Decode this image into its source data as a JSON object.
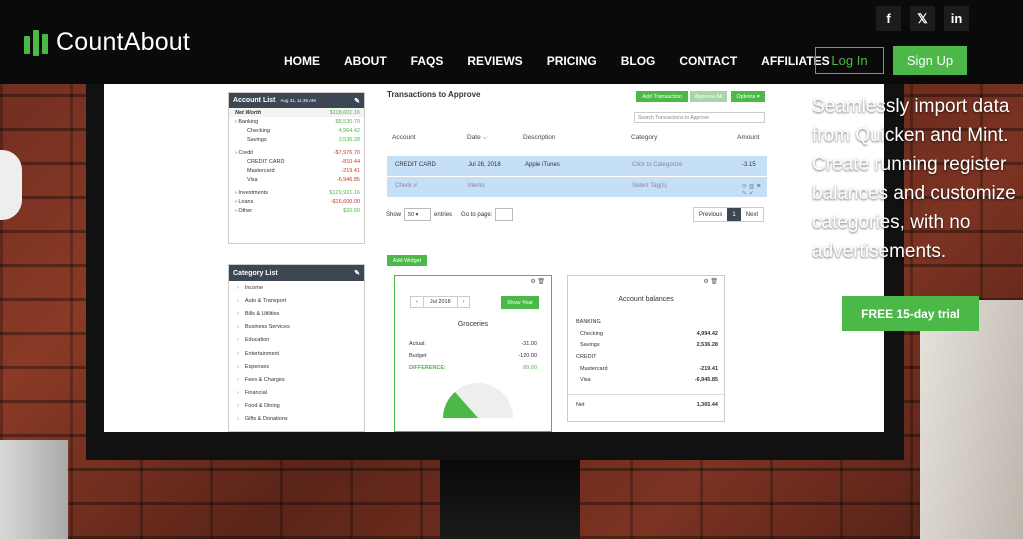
{
  "brand": {
    "name_part1": "Count",
    "name_part2": "About"
  },
  "social": [
    {
      "label": "f",
      "name": "facebook-icon"
    },
    {
      "label": "𝕏",
      "name": "twitter-icon"
    },
    {
      "label": "in",
      "name": "linkedin-icon"
    }
  ],
  "nav": [
    "HOME",
    "ABOUT",
    "FAQS",
    "REVIEWS",
    "PRICING",
    "BLOG",
    "CONTACT",
    "AFFILIATES"
  ],
  "auth": {
    "login": "Log In",
    "signup": "Sign Up"
  },
  "hero": {
    "text": "Seamlessly import data from Quicken and Mint. Create running register balances and customize categories, with no advertisements.",
    "cta": "FREE 15-day trial"
  },
  "app": {
    "account_list": {
      "title": "Account List",
      "date": "Aug 31, 11:35 AM",
      "rows": [
        {
          "label": "Net Worth",
          "value": "$118,601.16",
          "type": "hl",
          "color": "green"
        },
        {
          "label": "Banking",
          "value": "$8,530.70",
          "type": "group",
          "color": "green"
        },
        {
          "label": "Checking",
          "value": "4,964.42",
          "type": "sub",
          "color": "green"
        },
        {
          "label": "Savings",
          "value": "3,536.28",
          "type": "sub",
          "color": "green"
        },
        {
          "label": "",
          "value": "",
          "type": "spacer",
          "color": ""
        },
        {
          "label": "Credit",
          "value": "-$7,976.70",
          "type": "group",
          "color": "red"
        },
        {
          "label": "CREDIT CARD",
          "value": "-810.44",
          "type": "sub",
          "color": "red"
        },
        {
          "label": "Mastercard",
          "value": "-219.41",
          "type": "sub",
          "color": "red"
        },
        {
          "label": "Visa",
          "value": "-6,946.85",
          "type": "sub",
          "color": "red"
        },
        {
          "label": "",
          "value": "",
          "type": "spacer",
          "color": ""
        },
        {
          "label": "Investments",
          "value": "$129,921.16",
          "type": "group",
          "color": "green"
        },
        {
          "label": "Loans",
          "value": "-$16,600.00",
          "type": "group",
          "color": "red"
        },
        {
          "label": "Other",
          "value": "$20.00",
          "type": "group",
          "color": "green"
        }
      ]
    },
    "category_list": {
      "title": "Category List",
      "items": [
        "Income",
        "Auto & Transport",
        "Bills & Utilities",
        "Business Services",
        "Education",
        "Entertainment",
        "Expenses",
        "Fees & Charges",
        "Financial",
        "Food & Dining",
        "Gifts & Donations"
      ]
    },
    "transactions": {
      "title": "Transactions to Approve",
      "add_btn": "Add Transaction",
      "approve_btn": "Approve All",
      "options_btn": "Options ▾",
      "search_placeholder": "Search Transactions to Approve",
      "headers": [
        "Account",
        "Date ⌵",
        "Description",
        "Category",
        "Amount"
      ],
      "rows": [
        {
          "account": "CREDIT CARD",
          "date": "Jul 26, 2018",
          "description": "Apple iTunes",
          "category": "Click to Categorize",
          "amount": "-3.15"
        },
        {
          "account": "Check #",
          "date": "Memo",
          "description": "",
          "category": "Select Tag(s)",
          "amount": "⟳ ▥ ⚑ ✎ ✔"
        }
      ],
      "show_label": "Show",
      "show_value": "50",
      "entries_label": "entries",
      "goto_label": "Go to page:",
      "pager": [
        "Previous",
        "1",
        "Next"
      ]
    },
    "add_widget": "Add Widget",
    "widget_groceries": {
      "month": "Jul 2018",
      "show_year": "Show Year",
      "title": "Groceries",
      "rows": [
        {
          "label": "Actual:",
          "value": "-31.00"
        },
        {
          "label": "Budget",
          "value": "-120.00"
        },
        {
          "label": "DIFFERENCE:",
          "value": "89.00"
        }
      ]
    },
    "widget_balances": {
      "title": "Account balances",
      "rows": [
        {
          "label": "BANKING",
          "value": "",
          "indent": false
        },
        {
          "label": "Checking",
          "value": "4,994.42",
          "indent": true
        },
        {
          "label": "Savings",
          "value": "2,536.28",
          "indent": true
        },
        {
          "label": "CREDIT",
          "value": "",
          "indent": false
        },
        {
          "label": "Mastercard",
          "value": "-219.41",
          "indent": true
        },
        {
          "label": "Visa",
          "value": "-6,945.85",
          "indent": true
        }
      ],
      "net_label": "Net",
      "net_value": "1,365.44"
    }
  },
  "colors": {
    "accent": "#4cb847",
    "panel_header": "#3d4653",
    "row_highlight": "#c5dff7"
  }
}
